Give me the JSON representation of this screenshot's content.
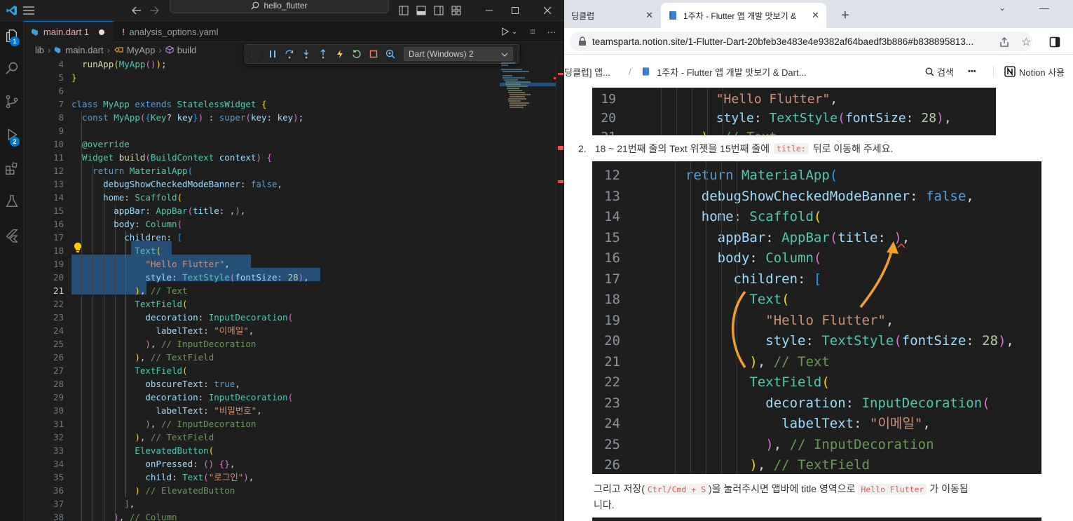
{
  "vscode": {
    "title": "hello_flutter",
    "tabs": [
      {
        "label": "main.dart 1",
        "active": true,
        "modified": true
      },
      {
        "label": "analysis_options.yaml",
        "active": false
      }
    ],
    "breadcrumb": [
      "lib",
      "main.dart",
      "MyApp",
      "build"
    ],
    "debug_config": "Dart (Windows) 2",
    "badges": {
      "explorer": "1",
      "run": "2"
    },
    "line_numbers": [
      "4",
      "5",
      "6",
      "7",
      "8",
      "9",
      "10",
      "11",
      "12",
      "13",
      "14",
      "15",
      "16",
      "17",
      "18",
      "19",
      "20",
      "21",
      "22",
      "23",
      "24",
      "25",
      "26",
      "27",
      "28",
      "29",
      "30",
      "31",
      "32",
      "33",
      "34",
      "35",
      "36",
      "37",
      "38"
    ]
  },
  "code_lines": [
    [
      [
        "  ",
        ""
      ],
      [
        "runApp",
        "fn"
      ],
      [
        "(",
        "br1"
      ],
      [
        "MyApp",
        "ty"
      ],
      [
        "(",
        "br2"
      ],
      [
        ")",
        "br2"
      ],
      [
        ")",
        "br1"
      ],
      [
        ";",
        ""
      ]
    ],
    [
      [
        "}",
        "br1"
      ]
    ],
    [],
    [
      [
        "class ",
        "kw"
      ],
      [
        "MyApp ",
        "ty"
      ],
      [
        "extends ",
        "kw"
      ],
      [
        "StatelessWidget ",
        "ty"
      ],
      [
        "{",
        "br1"
      ]
    ],
    [
      [
        "  const ",
        "kw"
      ],
      [
        "MyApp",
        "ty"
      ],
      [
        "(",
        "br2"
      ],
      [
        "{",
        "br3"
      ],
      [
        "Key",
        "ty"
      ],
      [
        "? ",
        ""
      ],
      [
        "key",
        "pr"
      ],
      [
        "}",
        "br3"
      ],
      [
        ")",
        "br2"
      ],
      [
        " : ",
        ""
      ],
      [
        "super",
        "kw"
      ],
      [
        "(",
        "br2"
      ],
      [
        "key",
        "pr"
      ],
      [
        ": ",
        ""
      ],
      [
        "key",
        "pr"
      ],
      [
        ")",
        "br2"
      ],
      [
        ";",
        ""
      ]
    ],
    [],
    [
      [
        "  @override",
        "ty"
      ]
    ],
    [
      [
        "  Widget ",
        "ty"
      ],
      [
        "build",
        "fn"
      ],
      [
        "(",
        "br2"
      ],
      [
        "BuildContext ",
        "ty"
      ],
      [
        "context",
        "pr"
      ],
      [
        ")",
        "br2"
      ],
      [
        " ",
        ""
      ],
      [
        "{",
        "br2"
      ]
    ],
    [
      [
        "    return ",
        "kw"
      ],
      [
        "MaterialApp",
        "ty"
      ],
      [
        "(",
        "br3"
      ]
    ],
    [
      [
        "      debugShowCheckedModeBanner",
        "pr"
      ],
      [
        ": ",
        ""
      ],
      [
        "false",
        "kw"
      ],
      [
        ",",
        ""
      ]
    ],
    [
      [
        "      home",
        "pr"
      ],
      [
        ": ",
        ""
      ],
      [
        "Scaffold",
        "ty"
      ],
      [
        "(",
        "br1"
      ]
    ],
    [
      [
        "        appBar",
        "pr"
      ],
      [
        ": ",
        ""
      ],
      [
        "AppBar",
        "ty"
      ],
      [
        "(",
        "br2"
      ],
      [
        "title",
        "pr"
      ],
      [
        ": ,",
        ""
      ],
      [
        ")",
        "br2"
      ],
      [
        ",",
        ""
      ]
    ],
    [
      [
        "        body",
        "pr"
      ],
      [
        ": ",
        ""
      ],
      [
        "Column",
        "ty"
      ],
      [
        "(",
        "br2"
      ]
    ],
    [
      [
        "          children",
        "pr"
      ],
      [
        ": ",
        ""
      ],
      [
        "[",
        "br3"
      ]
    ],
    [
      [
        "            Text",
        "ty"
      ],
      [
        "(",
        "br1"
      ]
    ],
    [
      [
        "              ",
        ""
      ],
      [
        "\"Hello Flutter\"",
        "str"
      ],
      [
        ",",
        ""
      ]
    ],
    [
      [
        "              style",
        "pr"
      ],
      [
        ": ",
        ""
      ],
      [
        "TextStyle",
        "ty"
      ],
      [
        "(",
        "br2"
      ],
      [
        "fontSize",
        "pr"
      ],
      [
        ": ",
        ""
      ],
      [
        "28",
        "num"
      ],
      [
        ")",
        "br2"
      ],
      [
        ",",
        ""
      ]
    ],
    [
      [
        "            ",
        ""
      ],
      [
        ")",
        "br1"
      ],
      [
        ", ",
        ""
      ],
      [
        "// Text",
        "cm"
      ]
    ],
    [
      [
        "            TextField",
        "ty"
      ],
      [
        "(",
        "br1"
      ]
    ],
    [
      [
        "              decoration",
        "pr"
      ],
      [
        ": ",
        ""
      ],
      [
        "InputDecoration",
        "ty"
      ],
      [
        "(",
        "br2"
      ]
    ],
    [
      [
        "                labelText",
        "pr"
      ],
      [
        ": ",
        ""
      ],
      [
        "\"이메일\"",
        "str"
      ],
      [
        ",",
        ""
      ]
    ],
    [
      [
        "              ",
        ""
      ],
      [
        ")",
        "br2"
      ],
      [
        ", ",
        ""
      ],
      [
        "// InputDecoration",
        "cm"
      ]
    ],
    [
      [
        "            ",
        ""
      ],
      [
        ")",
        "br1"
      ],
      [
        ", ",
        ""
      ],
      [
        "// TextField",
        "cm"
      ]
    ],
    [
      [
        "            TextField",
        "ty"
      ],
      [
        "(",
        "br1"
      ]
    ],
    [
      [
        "              obscureText",
        "pr"
      ],
      [
        ": ",
        ""
      ],
      [
        "true",
        "kw"
      ],
      [
        ",",
        ""
      ]
    ],
    [
      [
        "              decoration",
        "pr"
      ],
      [
        ": ",
        ""
      ],
      [
        "InputDecoration",
        "ty"
      ],
      [
        "(",
        "br2"
      ]
    ],
    [
      [
        "                labelText",
        "pr"
      ],
      [
        ": ",
        ""
      ],
      [
        "\"비밀번호\"",
        "str"
      ],
      [
        ",",
        ""
      ]
    ],
    [
      [
        "              ",
        ""
      ],
      [
        ")",
        "br2"
      ],
      [
        ", ",
        ""
      ],
      [
        "// InputDecoration",
        "cm"
      ]
    ],
    [
      [
        "            ",
        ""
      ],
      [
        ")",
        "br1"
      ],
      [
        ", ",
        ""
      ],
      [
        "// TextField",
        "cm"
      ]
    ],
    [
      [
        "            ElevatedButton",
        "ty"
      ],
      [
        "(",
        "br1"
      ]
    ],
    [
      [
        "              onPressed",
        "pr"
      ],
      [
        ": ",
        ""
      ],
      [
        "()",
        "br2"
      ],
      [
        " ",
        ""
      ],
      [
        "{}",
        "br2"
      ],
      [
        ",",
        ""
      ]
    ],
    [
      [
        "              child",
        "pr"
      ],
      [
        ": ",
        ""
      ],
      [
        "Text",
        "ty"
      ],
      [
        "(",
        "br2"
      ],
      [
        "\"로그인\"",
        "str"
      ],
      [
        ")",
        "br2"
      ],
      [
        ",",
        ""
      ]
    ],
    [
      [
        "            ",
        ""
      ],
      [
        ")",
        "br1"
      ],
      [
        " ",
        ""
      ],
      [
        "// ElevatedButton",
        "cm"
      ]
    ],
    [
      [
        "          ",
        ""
      ],
      [
        "]",
        "br3"
      ],
      [
        ",",
        ""
      ]
    ],
    [
      [
        "        ",
        ""
      ],
      [
        ")",
        "br2"
      ],
      [
        ", ",
        ""
      ],
      [
        "// Column",
        "cm"
      ]
    ]
  ],
  "browser": {
    "tabs": [
      {
        "label": "딩클럽",
        "active": false
      },
      {
        "label": "1주차 - Flutter 앱 개발 맛보기 &",
        "active": true
      }
    ],
    "url": "teamsparta.notion.site/1-Flutter-Dart-20bfeb3e483e4e9382af64baedf3b886#b838895813...",
    "notion_breadcrumb_1": "딩클럽] 앱...",
    "notion_breadcrumb_sep": "/",
    "notion_breadcrumb_2": "1주차 - Flutter 앱 개발 맛보기 & Dart...",
    "search_label": "검색",
    "more_label": "•••",
    "notion_label": "Notion 사용",
    "step_number": "2.",
    "step_text_before": "18 ~ 21번째 줄의 Text 위젯을 15번째 줄에",
    "step_code": "title:",
    "step_text_after": "뒤로 이동해 주세요.",
    "para_before": "그리고 저장(",
    "para_code1": "Ctrl/Cmd + S",
    "para_mid": ")을 눌러주시면 앱바에 title 영역으로",
    "para_code2": "Hello Flutter",
    "para_after": "가 이동됩",
    "para_line2": "니다.",
    "top_image_lines": [
      {
        "n": "19",
        "code": [
          [
            "        ",
            ""
          ],
          [
            "\"Hello Flutter\"",
            "str"
          ],
          [
            ",",
            ""
          ]
        ]
      },
      {
        "n": "20",
        "code": [
          [
            "        style",
            "pr"
          ],
          [
            ": ",
            ""
          ],
          [
            "TextStyle",
            "ty"
          ],
          [
            "(",
            "br2"
          ],
          [
            "fontSize",
            "pr"
          ],
          [
            ": ",
            ""
          ],
          [
            "28",
            "num"
          ],
          [
            ")",
            "br2"
          ],
          [
            ",",
            ""
          ]
        ]
      },
      {
        "n": "21",
        "code": [
          [
            "      ",
            ""
          ],
          [
            ")",
            "br1"
          ],
          [
            ", ",
            ""
          ],
          [
            "// Text",
            "cm"
          ]
        ]
      }
    ],
    "main_image_lines": [
      {
        "n": "12",
        "code": [
          [
            "  return ",
            "kw"
          ],
          [
            "MaterialApp",
            "ty"
          ],
          [
            "(",
            "br3"
          ]
        ]
      },
      {
        "n": "13",
        "code": [
          [
            "    debugShowCheckedModeBanner",
            "pr"
          ],
          [
            ": ",
            ""
          ],
          [
            "false",
            "kw"
          ],
          [
            ",",
            ""
          ]
        ]
      },
      {
        "n": "14",
        "code": [
          [
            "    home",
            "pr"
          ],
          [
            ": ",
            ""
          ],
          [
            "Scaffold",
            "ty"
          ],
          [
            "(",
            "br1"
          ]
        ]
      },
      {
        "n": "15",
        "code": [
          [
            "      appBar",
            "pr"
          ],
          [
            ": ",
            ""
          ],
          [
            "AppBar",
            "ty"
          ],
          [
            "(",
            "br2"
          ],
          [
            "title",
            "pr"
          ],
          [
            ": ",
            ""
          ],
          [
            ")",
            "br2"
          ],
          [
            ",",
            ""
          ]
        ]
      },
      {
        "n": "16",
        "code": [
          [
            "      body",
            "pr"
          ],
          [
            ": ",
            ""
          ],
          [
            "Column",
            "ty"
          ],
          [
            "(",
            "br2"
          ]
        ]
      },
      {
        "n": "17",
        "code": [
          [
            "        children",
            "pr"
          ],
          [
            ": ",
            ""
          ],
          [
            "[",
            "br3"
          ]
        ]
      },
      {
        "n": "18",
        "code": [
          [
            "          Text",
            "ty"
          ],
          [
            "(",
            "br1"
          ]
        ]
      },
      {
        "n": "19",
        "code": [
          [
            "            ",
            ""
          ],
          [
            "\"Hello Flutter\"",
            "str"
          ],
          [
            ",",
            ""
          ]
        ]
      },
      {
        "n": "20",
        "code": [
          [
            "            style",
            "pr"
          ],
          [
            ": ",
            ""
          ],
          [
            "TextStyle",
            "ty"
          ],
          [
            "(",
            "br2"
          ],
          [
            "fontSize",
            "pr"
          ],
          [
            ": ",
            ""
          ],
          [
            "28",
            "num"
          ],
          [
            ")",
            "br2"
          ],
          [
            ",",
            ""
          ]
        ]
      },
      {
        "n": "21",
        "code": [
          [
            "          ",
            ""
          ],
          [
            ")",
            "br1"
          ],
          [
            ", ",
            ""
          ],
          [
            "// Text",
            "cm"
          ]
        ]
      },
      {
        "n": "22",
        "code": [
          [
            "          TextField",
            "ty"
          ],
          [
            "(",
            "br1"
          ]
        ]
      },
      {
        "n": "23",
        "code": [
          [
            "            decoration",
            "pr"
          ],
          [
            ": ",
            ""
          ],
          [
            "InputDecoration",
            "ty"
          ],
          [
            "(",
            "br2"
          ]
        ]
      },
      {
        "n": "24",
        "code": [
          [
            "              labelText",
            "pr"
          ],
          [
            ": ",
            ""
          ],
          [
            "\"이메일\"",
            "str"
          ],
          [
            ",",
            ""
          ]
        ]
      },
      {
        "n": "25",
        "code": [
          [
            "            ",
            ""
          ],
          [
            ")",
            "br2"
          ],
          [
            ", ",
            ""
          ],
          [
            "// InputDecoration",
            "cm"
          ]
        ]
      },
      {
        "n": "26",
        "code": [
          [
            "          ",
            ""
          ],
          [
            ")",
            "br1"
          ],
          [
            ", ",
            ""
          ],
          [
            "// TextField",
            "cm"
          ]
        ]
      }
    ]
  },
  "colors": {
    "accent": "#0078d4",
    "arrow": "#f0a02b",
    "selection": "#264f78"
  },
  "icons": [
    "vscode-logo-icon",
    "menu-icon",
    "back-arrow-icon",
    "forward-arrow-icon",
    "search-icon",
    "layout-icon",
    "minimize-icon",
    "maximize-icon",
    "close-icon",
    "explorer-icon",
    "search-sidebar-icon",
    "source-control-icon",
    "run-debug-icon",
    "extensions-icon",
    "testing-icon",
    "flutter-icon",
    "run-icon",
    "split-editor-icon",
    "more-icon",
    "pause-icon",
    "step-over-icon",
    "step-into-icon",
    "step-out-icon",
    "hot-reload-icon",
    "restart-icon",
    "stop-icon",
    "devtools-icon",
    "lightbulb-icon",
    "notion-page-icon",
    "lock-icon",
    "share-icon",
    "star-icon",
    "sidebar-icon",
    "new-tab-icon",
    "chevron-down-icon"
  ]
}
